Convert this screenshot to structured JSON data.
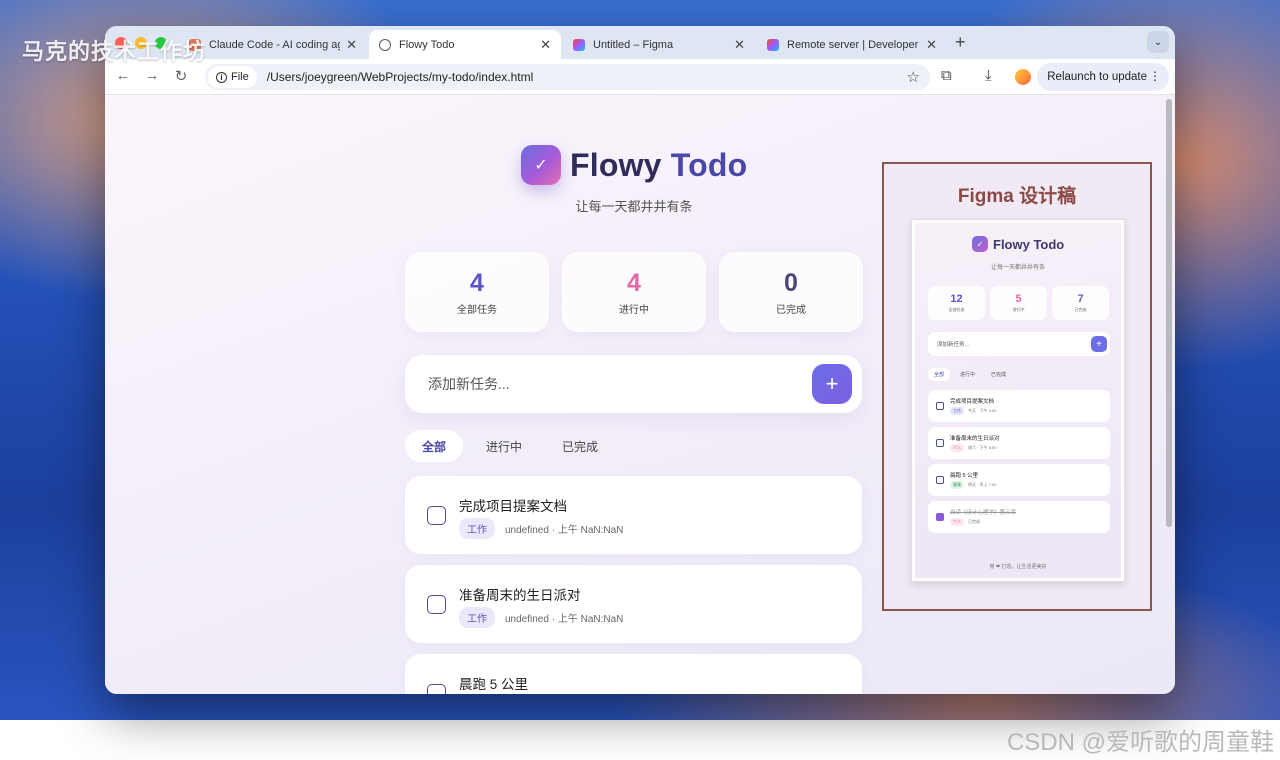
{
  "overlay": {
    "watermark_top": "马克的技术工作坊",
    "watermark_bottom": "CSDN @爱听歌的周童鞋"
  },
  "browser": {
    "tabs": [
      {
        "label": "Claude Code - AI coding agent",
        "active": false,
        "favicon": "claude-icon"
      },
      {
        "label": "Flowy Todo",
        "active": true,
        "favicon": "globe-icon"
      },
      {
        "label": "Untitled – Figma",
        "active": false,
        "favicon": "figma-icon"
      },
      {
        "label": "Remote server | Developer Do",
        "active": false,
        "favicon": "figma-icon"
      }
    ],
    "new_tab": "+",
    "file_label": "File",
    "url": "/Users/joeygreen/WebProjects/my-todo/index.html",
    "relaunch_label": "Relaunch to update",
    "nav_icons": {
      "back": "←",
      "forward": "→",
      "reload": "↻"
    },
    "toolbar_icons": {
      "star": "☆",
      "extensions": "⧉",
      "download": "⤓"
    }
  },
  "app": {
    "title_part1": "Flowy",
    "title_part2": " Todo",
    "logo_check": "✓",
    "subtitle": "让每一天都井井有条",
    "stats": [
      {
        "value": "4",
        "label": "全部任务",
        "color": "#5b55c8"
      },
      {
        "value": "4",
        "label": "进行中",
        "color": "#e36aa8"
      },
      {
        "value": "0",
        "label": "已完成",
        "color": "#4b4778"
      }
    ],
    "add_placeholder": "添加新任务...",
    "add_button": "+",
    "filters": [
      {
        "label": "全部",
        "active": true
      },
      {
        "label": "进行中",
        "active": false
      },
      {
        "label": "已完成",
        "active": false
      }
    ],
    "tasks": [
      {
        "title": "完成项目提案文档",
        "tag": "工作",
        "meta": "undefined · 上午 NaN:NaN"
      },
      {
        "title": "准备周末的生日派对",
        "tag": "工作",
        "meta": "undefined · 上午 NaN:NaN"
      },
      {
        "title": "晨跑 5 公里",
        "tag": "",
        "meta": ""
      }
    ]
  },
  "figma": {
    "title": "Figma 设计稿",
    "card": {
      "title": "Flowy Todo",
      "subtitle": "让每一天都井井有条",
      "stats": [
        {
          "value": "12",
          "label": "全部任务",
          "color": "#5b55c8"
        },
        {
          "value": "5",
          "label": "进行中",
          "color": "#e36aa8"
        },
        {
          "value": "7",
          "label": "已完成",
          "color": "#6b5fb0"
        }
      ],
      "add_placeholder": "添加新任务...",
      "filters": [
        "全部",
        "进行中",
        "已完成"
      ],
      "tasks": [
        {
          "title": "完成项目提案文档",
          "tag": "工作",
          "meta": "今天 · 下午 3:00",
          "done": false,
          "tag_bg": "#e6e4fb",
          "tag_color": "#5b55b8"
        },
        {
          "title": "准备周末的生日派对",
          "tag": "个人",
          "meta": "周六 · 下午 6:00",
          "done": false,
          "tag_bg": "#fde6ef",
          "tag_color": "#d0609a"
        },
        {
          "title": "晨跑 5 公里",
          "tag": "健康",
          "meta": "明天 · 早上 7:00",
          "done": false,
          "tag_bg": "#e2f5e8",
          "tag_color": "#3c9a5a"
        },
        {
          "title": "阅读《设计心理学》第三章",
          "tag": "个人",
          "meta": "已完成",
          "done": true,
          "tag_bg": "#fde6ef",
          "tag_color": "#d0609a"
        }
      ],
      "footer": "用 ❤ 打造，让生活更美好"
    }
  }
}
